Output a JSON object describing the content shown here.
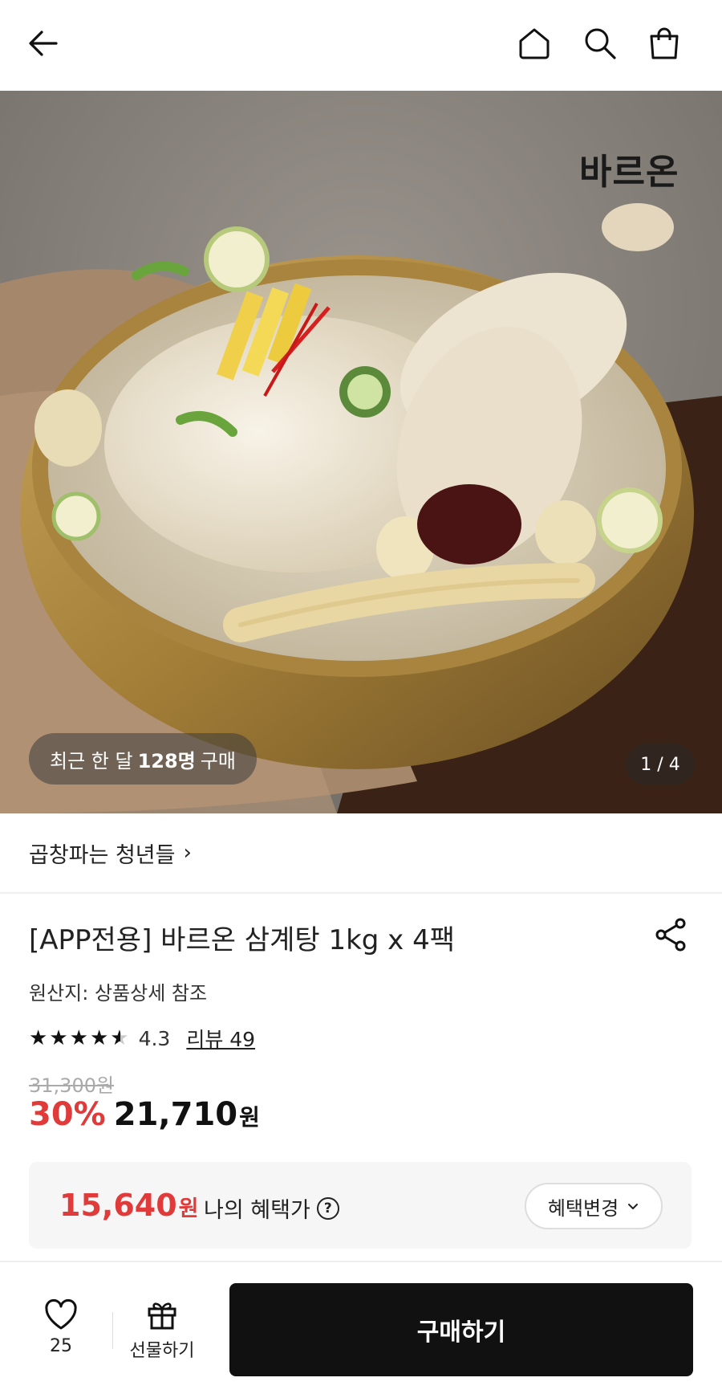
{
  "header": {
    "icons": [
      "back-arrow-icon",
      "home-icon",
      "search-icon",
      "shopping-bag-icon"
    ]
  },
  "hero": {
    "brand_logo": "바르온",
    "purchase_badge": {
      "prefix": "최근 한 달",
      "count": "128명",
      "suffix": "구매"
    },
    "image_counter": "1 / 4"
  },
  "store": {
    "name": "곱창파는 청년들",
    "chevron": "›"
  },
  "product": {
    "title": "[APP전용] 바르온 삼계탕 1kg x 4팩",
    "origin": "원산지: 상품상세 참조",
    "rating": "4.3",
    "rating_value": 4.3,
    "review_link": "리뷰 49",
    "original_price": "31,300원",
    "discount": "30%",
    "price": "21,710",
    "price_unit": "원"
  },
  "benefit": {
    "price": "15,640",
    "unit": "원",
    "label": "나의 혜택가",
    "help": "?",
    "change_button": "혜택변경"
  },
  "bottom_bar": {
    "like_count": "25",
    "gift_label": "선물하기",
    "buy_button": "구매하기"
  },
  "colors": {
    "accent_red": "#e03a3a",
    "dark_button": "#111111"
  }
}
